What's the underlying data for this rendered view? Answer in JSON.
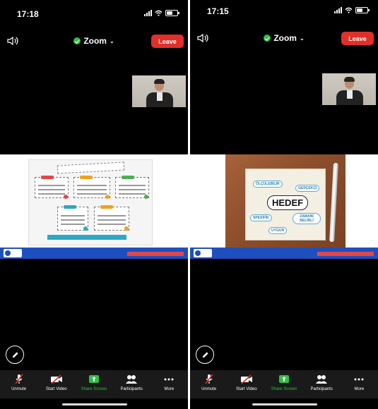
{
  "screens": [
    {
      "status_time": "17:18",
      "zoom_title": "Zoom",
      "leave_label": "Leave",
      "toolbar": {
        "unmute": "Unmute",
        "start_video": "Start Video",
        "share_screen": "Share Screen",
        "participants": "Participants",
        "more": "More"
      }
    },
    {
      "status_time": "17:15",
      "zoom_title": "Zoom",
      "leave_label": "Leave",
      "toolbar": {
        "unmute": "Unmute",
        "start_video": "Start Video",
        "share_screen": "Share Screen",
        "participants": "Participants",
        "more": "More"
      },
      "slide": {
        "words": [
          "HEDEF",
          "ÖLÇÜLEBİLİR",
          "GERÇEKÇİ",
          "SPESİFİK",
          "ZAMANI BELİRLİ",
          "UYGUN"
        ]
      }
    }
  ],
  "colors": {
    "leave": "#e0302a",
    "share": "#2fbf4a",
    "slide_footer": "#1e4fbf"
  }
}
